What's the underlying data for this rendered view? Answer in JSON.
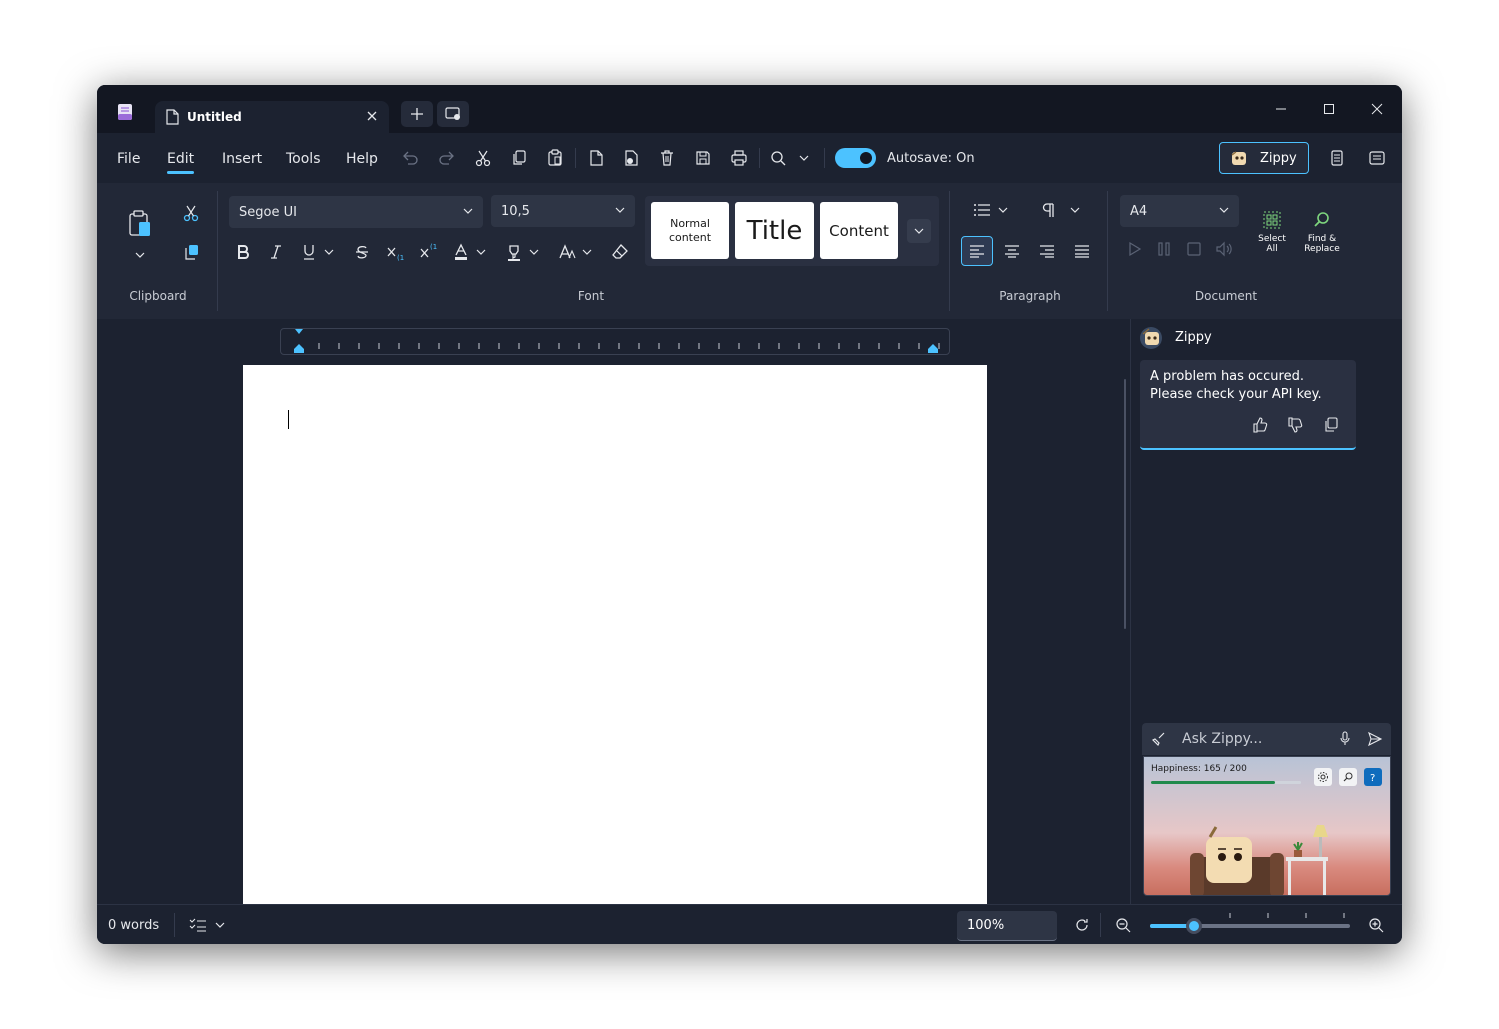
{
  "tab": {
    "title": "Untitled"
  },
  "menu": {
    "items": [
      "File",
      "Edit",
      "Insert",
      "Tools",
      "Help"
    ],
    "active": "Edit"
  },
  "autosave": {
    "label": "Autosave: On",
    "on": true
  },
  "zippy_button": {
    "label": "Zippy"
  },
  "ribbon": {
    "clipboard_label": "Clipboard",
    "font_label": "Font",
    "paragraph_label": "Paragraph",
    "document_label": "Document",
    "font_family": "Segoe UI",
    "font_size": "10,5",
    "styles": [
      "Normal content",
      "Title",
      "Content"
    ],
    "page_size": "A4",
    "select_all": "Select All",
    "find_replace": "Find & Replace"
  },
  "sidepanel": {
    "name": "Zippy",
    "message": "A problem has occured. Please check your API key.",
    "ask_placeholder": "Ask Zippy...",
    "happiness_label": "Happiness: 165 / 200",
    "happiness_value": 165,
    "happiness_max": 200
  },
  "status": {
    "words": "0 words",
    "zoom": "100%",
    "zoom_slider": 0.22
  },
  "colors": {
    "accent": "#4cc2ff",
    "background": "#1c2230",
    "ribbon": "#222837"
  }
}
